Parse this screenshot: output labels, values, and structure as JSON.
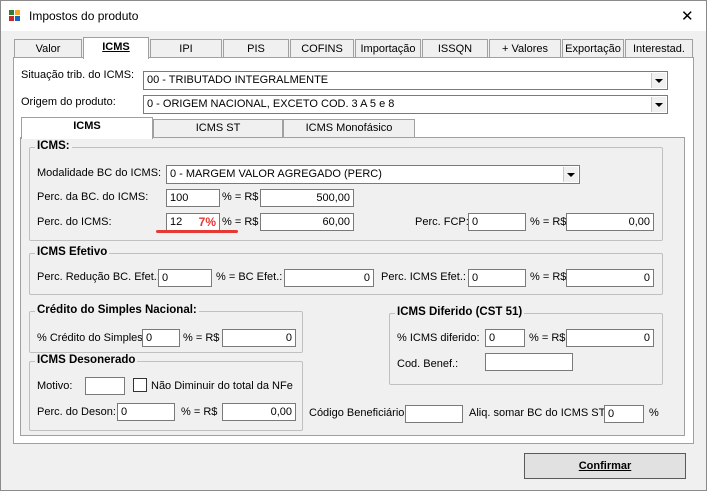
{
  "window": {
    "title": "Impostos do produto"
  },
  "tabs": [
    {
      "label": "Valor"
    },
    {
      "label": "ICMS"
    },
    {
      "label": "IPI"
    },
    {
      "label": "PIS"
    },
    {
      "label": "COFINS"
    },
    {
      "label": "Importação"
    },
    {
      "label": "ISSQN"
    },
    {
      "label": "+ Valores"
    },
    {
      "label": "Exportação"
    },
    {
      "label": "Interestad."
    }
  ],
  "situacao": {
    "label": "Situação trib. do ICMS:",
    "value": "00 - TRIBUTADO INTEGRALMENTE"
  },
  "origem": {
    "label": "Origem do produto:",
    "value": "0 - ORIGEM NACIONAL, EXCETO COD. 3 A 5 e 8"
  },
  "subtabs": [
    {
      "label": "ICMS"
    },
    {
      "label": "ICMS ST"
    },
    {
      "label": "ICMS Monofásico"
    }
  ],
  "icms": {
    "title": "ICMS:",
    "modalidade_label": "Modalidade BC do ICMS:",
    "modalidade_value": "0 - MARGEM VALOR AGREGADO (PERC)",
    "perc_bc_label": "Perc. da BC. do ICMS:",
    "perc_bc_value": "100",
    "eq_rs": "% = R$",
    "bc_value": "500,00",
    "perc_icms_label": "Perc. do ICMS:",
    "perc_icms_value": "12",
    "perc_icms_overlay": "7%",
    "icms_value": "60,00",
    "fcp_label": "Perc. FCP:",
    "fcp_perc": "0",
    "fcp_value": "0,00"
  },
  "efetivo": {
    "title": "ICMS Efetivo",
    "reducao_label": "Perc. Redução BC. Efet.:",
    "reducao_value": "0",
    "bc_label": "% = BC Efet.:",
    "bc_value": "0",
    "perc_label": "Perc. ICMS Efet.:",
    "perc_value": "0",
    "eq_rs": "% = R$",
    "value": "0"
  },
  "simples": {
    "title": "Crédito do Simples Nacional:",
    "label": "% Crédito do Simples:",
    "perc": "0",
    "eq_rs": "% = R$",
    "value": "0"
  },
  "diferido": {
    "title": "ICMS Diferido (CST 51)",
    "label": "% ICMS diferido:",
    "perc": "0",
    "eq_rs": "% = R$",
    "value": "0",
    "benef_label": "Cod. Benef.:",
    "benef_value": ""
  },
  "desonerado": {
    "title": "ICMS Desonerado",
    "motivo_label": "Motivo:",
    "motivo_value": "",
    "checkbox_label": "Não Diminuir do total da NFe",
    "perc_label": "Perc. do Deson:",
    "perc_value": "0",
    "eq_rs": "% = R$",
    "value": "0,00"
  },
  "footer": {
    "cod_benef_label": "Código Beneficiário:",
    "cod_benef_value": "",
    "aliq_label": "Aliq. somar BC do ICMS ST:",
    "aliq_value": "0",
    "aliq_unit": "%"
  },
  "confirm_button": "Confirmar",
  "colors": {
    "accent_red": "#e53935"
  }
}
